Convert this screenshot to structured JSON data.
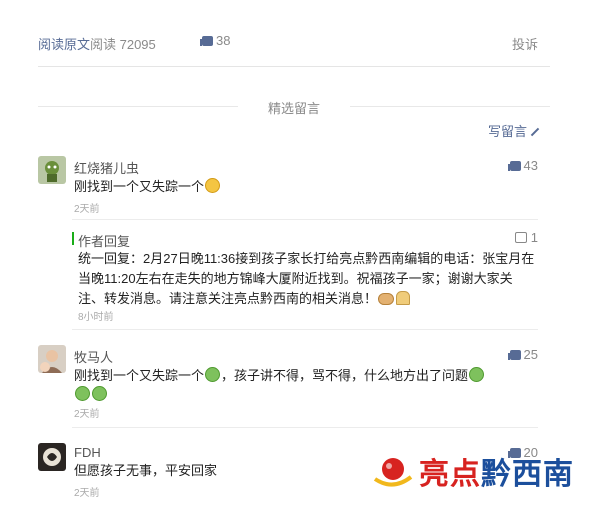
{
  "topbar": {
    "read_original": "阅读原文",
    "reads": "阅读 72095",
    "likes": "38",
    "report": "投诉"
  },
  "section": {
    "title": "精选留言",
    "write": "写留言"
  },
  "comments": [
    {
      "nick": "红烧猪儿虫",
      "content": "刚找到一个又失踪一个",
      "time": "2天前",
      "likes": "43"
    },
    {
      "nick": "牧马人",
      "content_a": "刚找到一个又失踪一个",
      "content_b": "，孩子讲不得，骂不得，什么地方出了问题",
      "time": "2天前",
      "likes": "25"
    },
    {
      "nick": "FDH",
      "content": "但愿孩子无事，平安回家",
      "time": "2天前",
      "likes": "20"
    }
  ],
  "reply": {
    "author": "作者回复",
    "content": "统一回复：2月27日晚11:36接到孩子家长打给亮点黔西南编辑的电话：张宝月在当晚11:20左右在走失的地方锦峰大厦附近找到。祝福孩子一家；谢谢大家关注、转发消息。请注意关注亮点黔西南的相关消息！",
    "time": "8小时前",
    "likes": "1"
  },
  "watermark": {
    "part_a": "亮点",
    "part_b": "黔西南"
  },
  "colors": {
    "link": "#576b95",
    "reply_bar": "#1aad19",
    "brand_red": "#d72320",
    "brand_blue": "#1c4f9c"
  }
}
